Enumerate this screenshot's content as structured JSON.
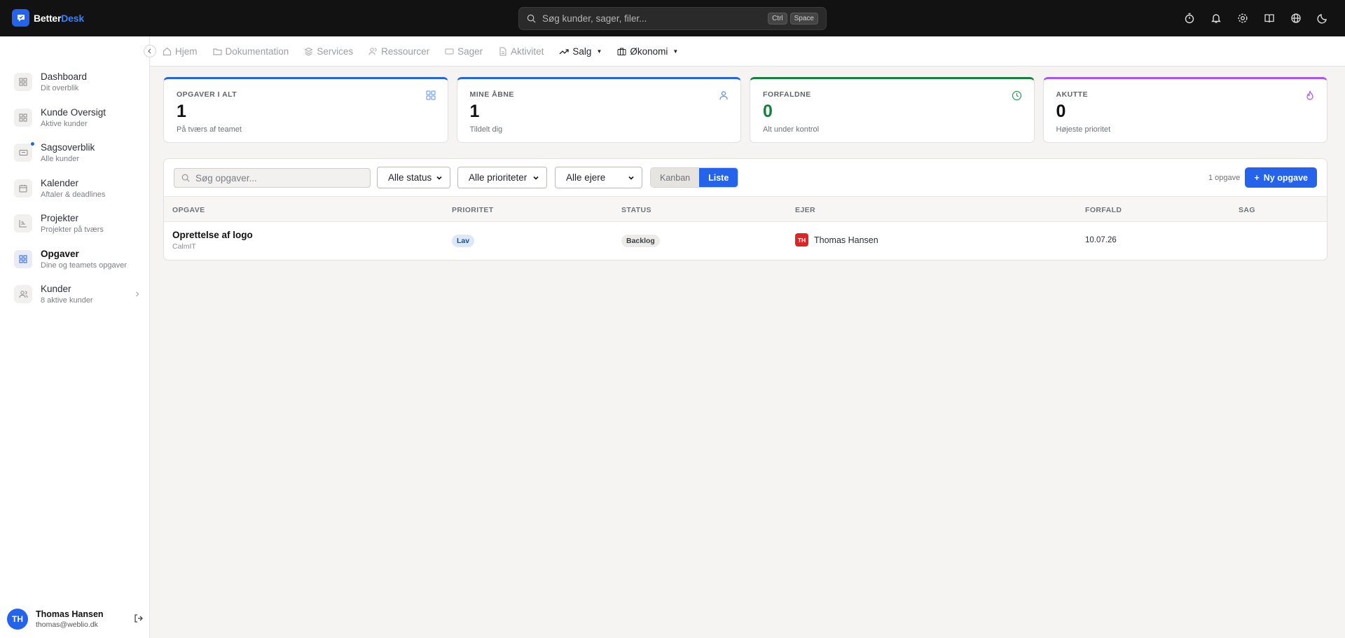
{
  "app": {
    "brand_a": "Better",
    "brand_b": "Desk",
    "search_placeholder": "Søg kunder, sager, filer...",
    "kbd_1": "Ctrl",
    "kbd_2": "Space"
  },
  "top_icons": [
    "timer-icon",
    "bell-icon",
    "gear-icon",
    "book-icon",
    "globe-icon",
    "moon-icon"
  ],
  "sidebar": {
    "items": [
      {
        "label": "Dashboard",
        "sub": "Dit overblik"
      },
      {
        "label": "Kunde Oversigt",
        "sub": "Aktive kunder"
      },
      {
        "label": "Sagsoverblik",
        "sub": "Alle kunder"
      },
      {
        "label": "Kalender",
        "sub": "Aftaler & deadlines"
      },
      {
        "label": "Projekter",
        "sub": "Projekter på tværs"
      },
      {
        "label": "Opgaver",
        "sub": "Dine og teamets opgaver"
      },
      {
        "label": "Kunder",
        "sub": "8 aktive kunder"
      }
    ],
    "user": {
      "initials": "TH",
      "name": "Thomas Hansen",
      "email": "thomas@weblio.dk"
    }
  },
  "tabs": [
    "Hjem",
    "Dokumentation",
    "Services",
    "Ressourcer",
    "Sager",
    "Aktivitet",
    "Salg",
    "Økonomi"
  ],
  "stats": [
    {
      "title": "OPGAVER I ALT",
      "value": "1",
      "sub": "På tværs af teamet"
    },
    {
      "title": "MINE ÅBNE",
      "value": "1",
      "sub": "Tildelt dig"
    },
    {
      "title": "FORFALDNE",
      "value": "0",
      "sub": "Alt under kontrol"
    },
    {
      "title": "AKUTTE",
      "value": "0",
      "sub": "Højeste prioritet"
    }
  ],
  "toolbar": {
    "search_placeholder": "Søg opgaver...",
    "status": "Alle status",
    "priority": "Alle prioriteter",
    "owners": "Alle ejere",
    "kanban": "Kanban",
    "list": "Liste",
    "count": "1 opgave",
    "new_task": "Ny opgave"
  },
  "table": {
    "headers": [
      "OPGAVE",
      "PRIORITET",
      "STATUS",
      "EJER",
      "FORFALD",
      "SAG"
    ],
    "rows": [
      {
        "title": "Oprettelse af logo",
        "customer": "CalmIT",
        "priority": "Lav",
        "status": "Backlog",
        "owner_initials": "TH",
        "owner": "Thomas Hansen",
        "due": "10.07.26",
        "case": ""
      }
    ]
  },
  "colors": {
    "accent": "#2563eb",
    "green": "#15803d",
    "purple": "#a855f7",
    "owner_badge": "#dc2626"
  }
}
